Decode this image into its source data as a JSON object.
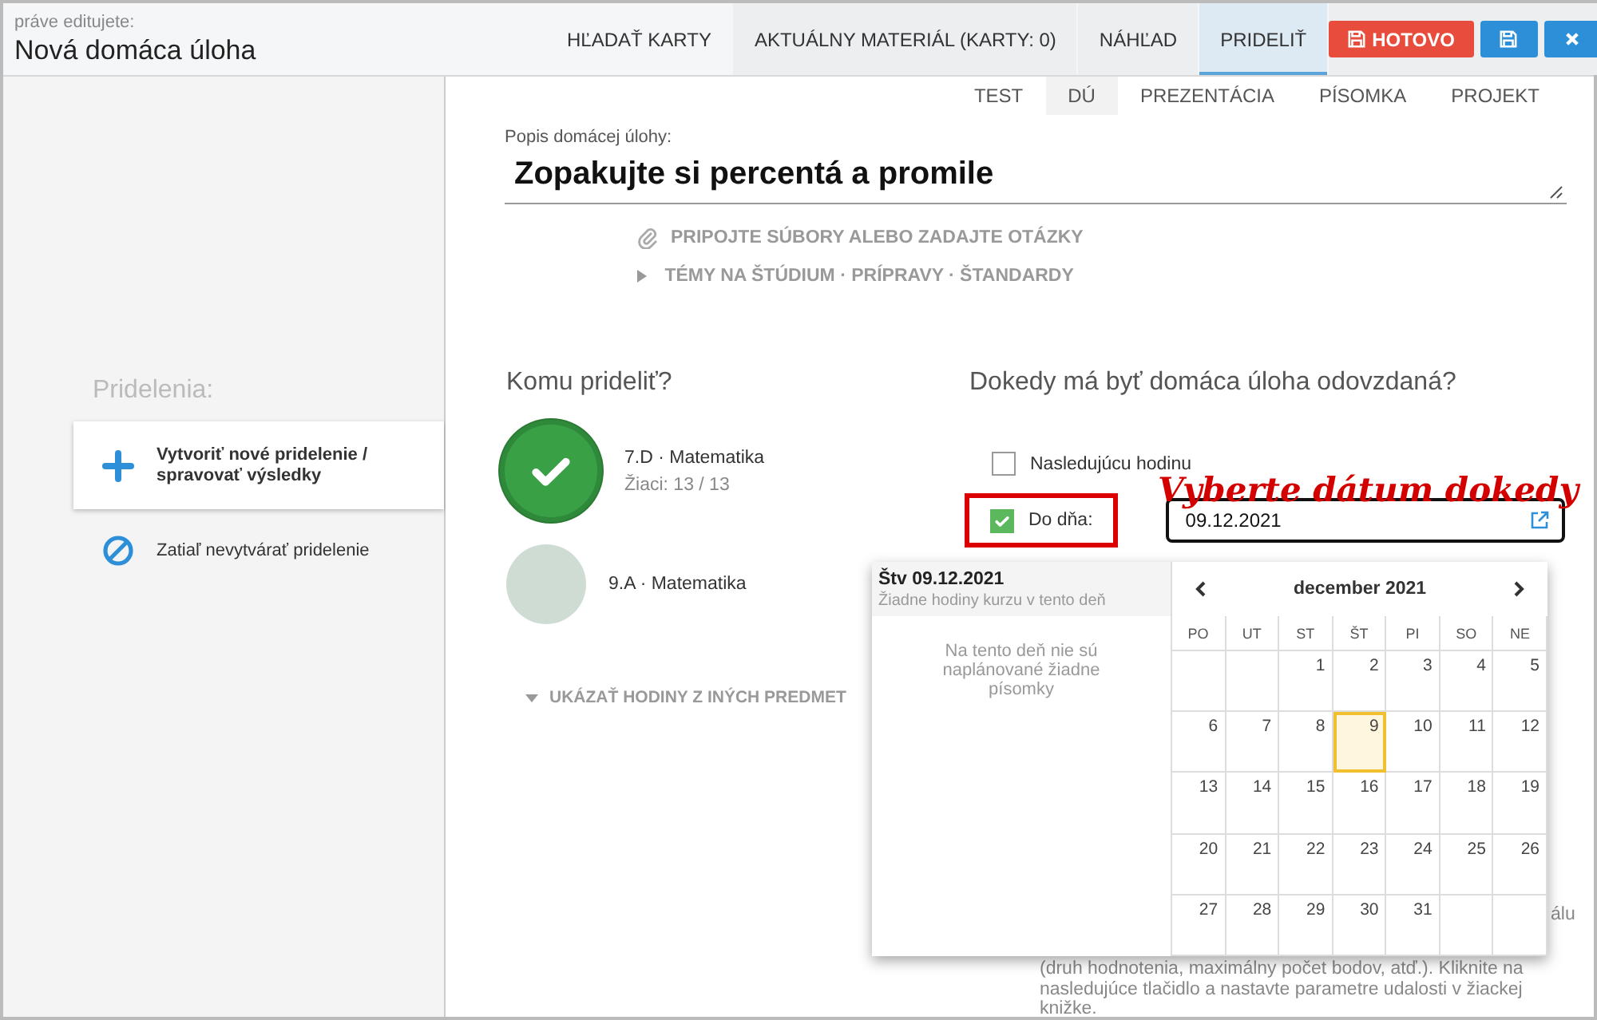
{
  "header": {
    "caption": "práve editujete:",
    "title": "Nová domáca úloha"
  },
  "tabs": [
    {
      "label": "HĽADAŤ KARTY",
      "selected": false
    },
    {
      "label": "AKTUÁLNY MATERIÁL (KARTY: 0)",
      "selected": false
    },
    {
      "label": "NÁHĽAD",
      "selected": false
    },
    {
      "label": "PRIDELIŤ",
      "selected": true
    }
  ],
  "buttons": {
    "done": "HOTOVO"
  },
  "type_tabs": [
    {
      "label": "TEST",
      "selected": false
    },
    {
      "label": "DÚ",
      "selected": true
    },
    {
      "label": "PREZENTÁCIA",
      "selected": false
    },
    {
      "label": "PÍSOMKA",
      "selected": false
    },
    {
      "label": "PROJEKT",
      "selected": false
    }
  ],
  "description": {
    "label": "Popis domácej úlohy:",
    "value": "Zopakujte si percentá a promile"
  },
  "attach_link": "PRIPOJTE SÚBORY ALEBO ZADAJTE OTÁZKY",
  "topics_link": "TÉMY NA ŠTÚDIUM · PRÍPRAVY · ŠTANDARDY",
  "sidebar": {
    "title": "Pridelenia:",
    "items": [
      {
        "kind": "create",
        "label": "Vytvoriť nové pridelenie / spravovať výsledky",
        "selected": true
      },
      {
        "kind": "none",
        "label": "Zatiaľ nevytvárať pridelenie",
        "selected": false
      }
    ]
  },
  "assign": {
    "title": "Komu prideliť?",
    "classes": [
      {
        "name": "7.D · Matematika",
        "students": "Žiaci: 13 / 13",
        "selected": true
      },
      {
        "name": "9.A · Matematika",
        "selected": false
      }
    ],
    "more": "UKÁZAŤ HODINY Z INÝCH PREDMET"
  },
  "due": {
    "title": "Dokedy má byť domáca úloha odovzdaná?",
    "options": [
      {
        "label": "Nasledujúcu hodinu",
        "checked": false
      },
      {
        "label": "Do dňa:",
        "checked": true
      }
    ],
    "date": "09.12.2021",
    "note_fragment": "álu",
    "note": "(druh hodnotenia, maximálny počet bodov, atď.). Kliknite na nasledujúce tlačidlo a nastavte parametre udalosti v žiackej knižke."
  },
  "annotation": "Vyberte dátum dokedy",
  "calendar": {
    "day_title": "Štv 09.12.2021",
    "day_subtitle": "Žiadne hodiny kurzu v tento deň",
    "empty_message": "Na tento deň nie sú naplánované žiadne písomky",
    "month": "december 2021",
    "weekdays": [
      "PO",
      "UT",
      "ST",
      "ŠT",
      "PI",
      "SO",
      "NE"
    ],
    "weeks": [
      [
        {
          "day": "1",
          "selected": false
        },
        {
          "day": "2",
          "selected": false
        },
        {
          "day": "3",
          "selected": false
        },
        {
          "day": "4",
          "selected": false
        },
        {
          "day": "5",
          "selected": false
        }
      ],
      [
        {
          "day": "6",
          "selected": false
        },
        {
          "day": "7",
          "selected": false
        },
        {
          "day": "8",
          "selected": false
        },
        {
          "day": "9",
          "selected": true
        },
        {
          "day": "10",
          "selected": false
        },
        {
          "day": "11",
          "selected": false
        },
        {
          "day": "12",
          "selected": false
        }
      ],
      [
        {
          "day": "13",
          "selected": false
        },
        {
          "day": "14",
          "selected": false
        },
        {
          "day": "15",
          "selected": false
        },
        {
          "day": "16",
          "selected": false
        },
        {
          "day": "17",
          "selected": false
        },
        {
          "day": "18",
          "selected": false
        },
        {
          "day": "19",
          "selected": false
        }
      ],
      [
        {
          "day": "20",
          "selected": false
        },
        {
          "day": "21",
          "selected": false
        },
        {
          "day": "22",
          "selected": false
        },
        {
          "day": "23",
          "selected": false
        },
        {
          "day": "24",
          "selected": false
        },
        {
          "day": "25",
          "selected": false
        },
        {
          "day": "26",
          "selected": false
        }
      ],
      [
        {
          "day": "27",
          "selected": false
        },
        {
          "day": "28",
          "selected": false
        },
        {
          "day": "29",
          "selected": false
        },
        {
          "day": "30",
          "selected": false
        },
        {
          "day": "31",
          "selected": false
        }
      ]
    ]
  }
}
